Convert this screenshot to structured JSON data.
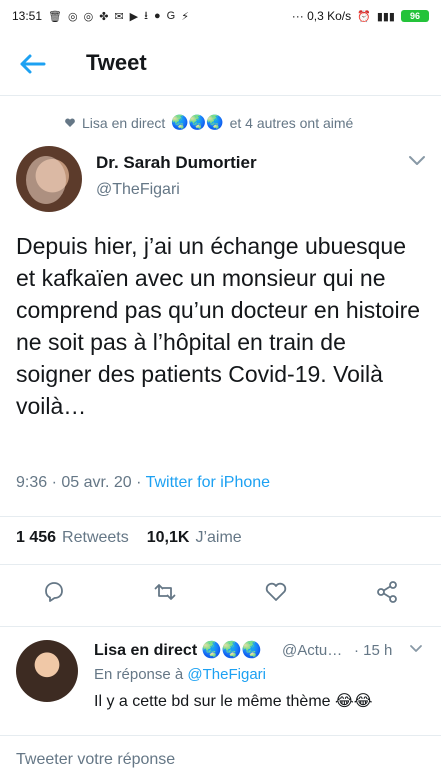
{
  "status_bar": {
    "time": "13:51",
    "network_speed": "··· 0,3 Ko/s",
    "battery": "96"
  },
  "header": {
    "title": "Tweet",
    "back_icon": "arrow-left-icon"
  },
  "liked_by": {
    "prefix": "Lisa en direct",
    "emoji": "🌏🌏🌏",
    "suffix": "et 4 autres ont aimé"
  },
  "tweet": {
    "author_name": "Dr. Sarah Dumortier",
    "author_handle": "@TheFigari",
    "text": "Depuis hier, j’ai un échange ubuesque et kafkaïen avec un monsieur qui ne comprend pas qu’un docteur en histoire ne soit pas à l’hôpital en train de soigner des patients Covid-19. Voilà voilà…",
    "time_date": "9:36 · 05 avr. 20 ·",
    "source": "Twitter for iPhone",
    "retweets_count": "1 456",
    "retweets_label": "Retweets",
    "likes_count": "10,1K",
    "likes_label": "J’aime"
  },
  "actions": {
    "reply": "reply-icon",
    "retweet": "retweet-icon",
    "like": "heart-icon",
    "share": "share-icon"
  },
  "reply": {
    "author_name": "Lisa en direct 🌏🌏🌏",
    "author_handle": "@Actu…",
    "time": "· 15 h",
    "reply_to_prefix": "En réponse à",
    "reply_to_handle": "@TheFigari",
    "text": "Il y a cette bd sur le même thème 😂😂"
  },
  "composer": {
    "placeholder": "Tweeter votre réponse"
  },
  "colors": {
    "accent": "#1da1f2",
    "muted": "#657786",
    "text": "#14171a"
  }
}
